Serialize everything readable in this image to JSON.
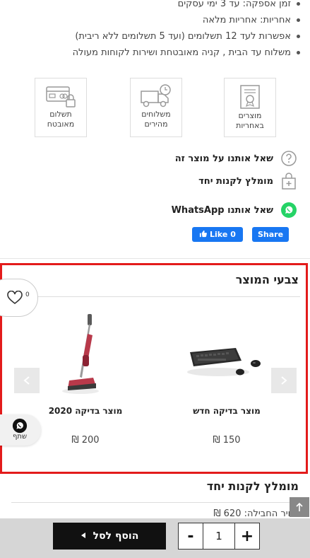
{
  "bullets": [
    "זמן אספקה: עד 3 ימי עסקים",
    "אחריות: אחריות מלאה",
    "אפשרות לעד 12 תשלומים (ועד 5 תשלומים ללא ריבית)",
    "משלוח עד הבית , קניה מאובטחת ושירות לקוחות מעולה"
  ],
  "features": {
    "warranty": "מוצרים באחריות",
    "shipping": "משלוחים מהירים",
    "payment": "תשלום מאובטח"
  },
  "actions": {
    "ask": "שאל אותנו על מוצר זה",
    "recommend": "מומלץ לקנות יחד",
    "whatsapp": "שאל אותנו WhatsApp"
  },
  "social": {
    "like": "Like",
    "like_count": "0",
    "share": "Share"
  },
  "related": {
    "title": "צבעי המוצר",
    "wishlist_count": "0",
    "products": [
      {
        "name": "מוצר בדיקה חדש",
        "price": "150 ₪"
      },
      {
        "name": "מוצר בדיקה 2020",
        "price": "200 ₪"
      }
    ]
  },
  "whatsapp_share": {
    "label": "שתף"
  },
  "lower": {
    "title": "מומלץ לקנות יחד",
    "price_line": "מחיר החבילה: 620 ₪"
  },
  "cart": {
    "add_label": "הוסף לסל",
    "quantity": "1",
    "minus": "-",
    "plus": "+"
  },
  "colors": {
    "accent_red": "#e31b1b",
    "facebook": "#1877f2",
    "whatsapp": "#25d366",
    "cart_button": "#111111"
  }
}
